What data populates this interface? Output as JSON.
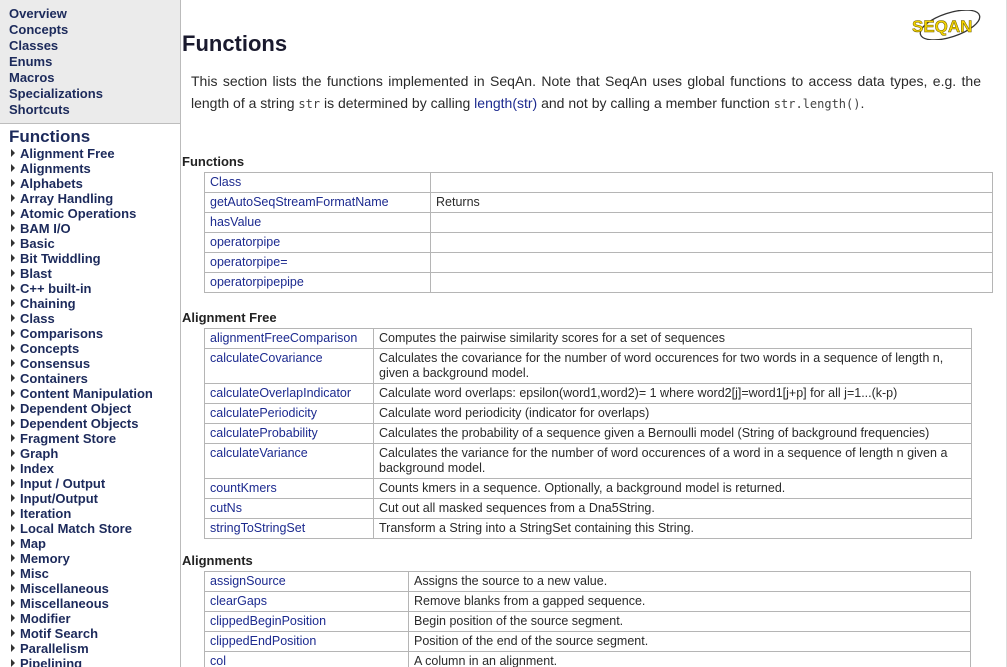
{
  "sidebar": {
    "top_links": [
      "Overview",
      "Concepts",
      "Classes",
      "Enums",
      "Macros",
      "Specializations",
      "Shortcuts"
    ],
    "heading": "Functions",
    "items": [
      "Alignment Free",
      "Alignments",
      "Alphabets",
      "Array Handling",
      "Atomic Operations",
      "BAM I/O",
      "Basic",
      "Bit Twiddling",
      "Blast",
      "C++ built-in",
      "Chaining",
      "Class",
      "Comparisons",
      "Concepts",
      "Consensus",
      "Containers",
      "Content Manipulation",
      "Dependent Object",
      "Dependent Objects",
      "Fragment Store",
      "Graph",
      "Index",
      "Input / Output",
      "Input/Output",
      "Iteration",
      "Local Match Store",
      "Map",
      "Memory",
      "Misc",
      "Miscellaneous",
      "Miscellaneous",
      "Modifier",
      "Motif Search",
      "Parallelism",
      "Pipelining"
    ]
  },
  "page": {
    "title": "Functions",
    "logo": "SEQAN",
    "intro": {
      "p1": "This section lists the functions implemented in SeqAn. Note that SeqAn uses global functions to access data types, e.g. the length of a string ",
      "code1": "str",
      "p2": " is determined by calling ",
      "link": "length(str)",
      "p3": " and not by calling a member function ",
      "code2": "str.length()",
      "p4": "."
    }
  },
  "sections": {
    "functions": {
      "title": "Functions",
      "rows": [
        {
          "name": "Class",
          "desc": ""
        },
        {
          "name": "getAutoSeqStreamFormatName",
          "desc": "Returns"
        },
        {
          "name": "hasValue",
          "desc": ""
        },
        {
          "name": "operatorpipe",
          "desc": ""
        },
        {
          "name": "operatorpipe=",
          "desc": ""
        },
        {
          "name": "operatorpipepipe",
          "desc": ""
        }
      ]
    },
    "alignment_free": {
      "title": "Alignment Free",
      "rows": [
        {
          "name": "alignmentFreeComparison",
          "desc": "Computes the pairwise similarity scores for a set of sequences"
        },
        {
          "name": "calculateCovariance",
          "desc": "Calculates the covariance for the number of word occurences for two words in a sequence of length n, given a background model."
        },
        {
          "name": "calculateOverlapIndicator",
          "desc": "Calculate word overlaps: epsilon(word1,word2)= 1 where word2[j]=word1[j+p] for all j=1...(k-p)"
        },
        {
          "name": "calculatePeriodicity",
          "desc": "Calculate word periodicity (indicator for overlaps)"
        },
        {
          "name": "calculateProbability",
          "desc": "Calculates the probability of a sequence given a Bernoulli model (String of background frequencies)"
        },
        {
          "name": "calculateVariance",
          "desc": "Calculates the variance for the number of word occurences of a word in a sequence of length n given a background model."
        },
        {
          "name": "countKmers",
          "desc": "Counts kmers in a sequence. Optionally, a background model is returned."
        },
        {
          "name": "cutNs",
          "desc": "Cut out all masked sequences from a Dna5String."
        },
        {
          "name": "stringToStringSet",
          "desc": "Transform a String into a StringSet containing this String."
        }
      ]
    },
    "alignments": {
      "title": "Alignments",
      "rows": [
        {
          "name": "assignSource",
          "desc": "Assigns the source to a new value."
        },
        {
          "name": "clearGaps",
          "desc": "Remove blanks from a gapped sequence."
        },
        {
          "name": "clippedBeginPosition",
          "desc": "Begin position of the source segment."
        },
        {
          "name": "clippedEndPosition",
          "desc": "Position of the end of the source segment."
        },
        {
          "name": "col",
          "desc": "A column in an alignment."
        }
      ]
    }
  },
  "colors": {
    "link": "#1c2a8f",
    "nav_bg": "#ebebeb",
    "logo_yellow": "#f2d200"
  }
}
